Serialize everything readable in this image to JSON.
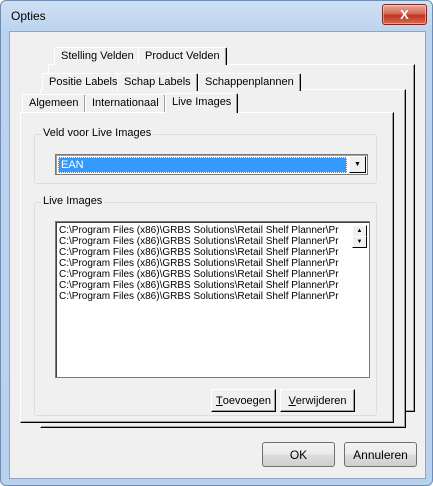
{
  "window": {
    "title": "Opties",
    "close_glyph": "X"
  },
  "tabs": {
    "row1": [
      "Stelling Velden",
      "Product Velden"
    ],
    "row2": [
      "Positie Labels",
      "Schap Labels",
      "Schappenplannen"
    ],
    "row3": [
      "Algemeen",
      "Internationaal",
      "Live Images"
    ],
    "active": "Live Images"
  },
  "field_group": {
    "title": "Veld voor Live Images",
    "combo_value": "EAN",
    "combo_icon": "chevron-down-icon"
  },
  "images_group": {
    "title": "Live Images",
    "items": [
      "C:\\Program Files (x86)\\GRBS Solutions\\Retail Shelf Planner\\Pr",
      "C:\\Program Files (x86)\\GRBS Solutions\\Retail Shelf Planner\\Pr",
      "C:\\Program Files (x86)\\GRBS Solutions\\Retail Shelf Planner\\Pr",
      "C:\\Program Files (x86)\\GRBS Solutions\\Retail Shelf Planner\\Pr",
      "C:\\Program Files (x86)\\GRBS Solutions\\Retail Shelf Planner\\Pr",
      "C:\\Program Files (x86)\\GRBS Solutions\\Retail Shelf Planner\\Pr",
      "C:\\Program Files (x86)\\GRBS Solutions\\Retail Shelf Planner\\Pr"
    ],
    "add_first": "T",
    "add_rest": "oevoegen",
    "remove_first": "V",
    "remove_rest": "erwijderen"
  },
  "footer": {
    "ok_label": "OK",
    "cancel_label": "Annuleren"
  }
}
